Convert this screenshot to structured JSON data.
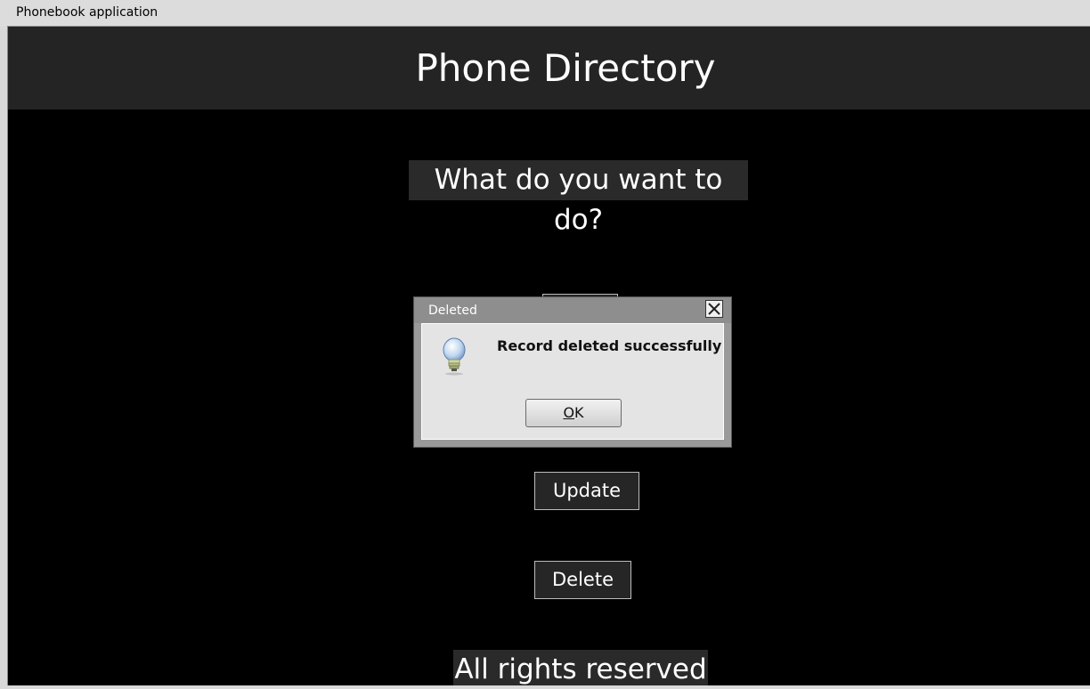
{
  "window": {
    "title": "Phonebook application"
  },
  "header": {
    "title": "Phone Directory"
  },
  "main": {
    "question": "What do you want to do?",
    "buttons": {
      "update": "Update",
      "delete": "Delete"
    },
    "footer": "All rights reserved"
  },
  "dialog": {
    "title": "Deleted",
    "message": "Record deleted successfully",
    "ok_mnemonic": "O",
    "ok_rest": "K",
    "icon": "lightbulb-icon"
  },
  "colors": {
    "background": "#000000",
    "header_bg": "#242424",
    "text": "#ffffff",
    "dialog_bg": "#e4e4e4"
  }
}
